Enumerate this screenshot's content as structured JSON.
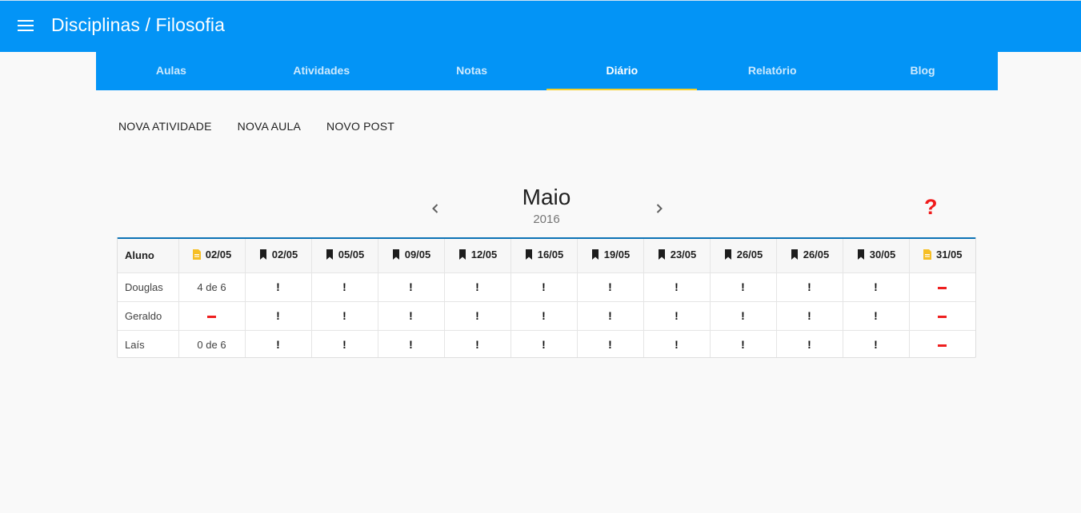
{
  "app": {
    "title": "Disciplinas / Filosofia",
    "primary_color": "#0394f6",
    "accent_color": "#f5cf29"
  },
  "tabs": [
    {
      "label": "Aulas",
      "active": false
    },
    {
      "label": "Atividades",
      "active": false
    },
    {
      "label": "Notas",
      "active": false
    },
    {
      "label": "Diário",
      "active": true
    },
    {
      "label": "Relatório",
      "active": false
    },
    {
      "label": "Blog",
      "active": false
    }
  ],
  "actions": {
    "nova_atividade": "NOVA ATIVIDADE",
    "nova_aula": "NOVA AULA",
    "novo_post": "NOVO POST"
  },
  "calendar": {
    "month": "Maio",
    "year": "2016",
    "prev_icon": "chevron-left-icon",
    "next_icon": "chevron-right-icon",
    "help_symbol": "?"
  },
  "table": {
    "student_header": "Aluno",
    "columns": [
      {
        "date": "02/05",
        "icon": "document-icon"
      },
      {
        "date": "02/05",
        "icon": "bookmark-icon"
      },
      {
        "date": "05/05",
        "icon": "bookmark-icon"
      },
      {
        "date": "09/05",
        "icon": "bookmark-icon"
      },
      {
        "date": "12/05",
        "icon": "bookmark-icon"
      },
      {
        "date": "16/05",
        "icon": "bookmark-icon"
      },
      {
        "date": "19/05",
        "icon": "bookmark-icon"
      },
      {
        "date": "23/05",
        "icon": "bookmark-icon"
      },
      {
        "date": "26/05",
        "icon": "bookmark-icon"
      },
      {
        "date": "26/05",
        "icon": "bookmark-icon"
      },
      {
        "date": "30/05",
        "icon": "bookmark-icon"
      },
      {
        "date": "31/05",
        "icon": "document-icon"
      }
    ],
    "rows": [
      {
        "name": "Douglas",
        "cells": [
          "4 de 6",
          "!",
          "!",
          "!",
          "!",
          "!",
          "!",
          "!",
          "!",
          "!",
          "!",
          "-"
        ]
      },
      {
        "name": "Geraldo",
        "cells": [
          "-",
          "!",
          "!",
          "!",
          "!",
          "!",
          "!",
          "!",
          "!",
          "!",
          "!",
          "-"
        ]
      },
      {
        "name": "Laís",
        "cells": [
          "0 de 6",
          "!",
          "!",
          "!",
          "!",
          "!",
          "!",
          "!",
          "!",
          "!",
          "!",
          "-"
        ]
      }
    ]
  }
}
